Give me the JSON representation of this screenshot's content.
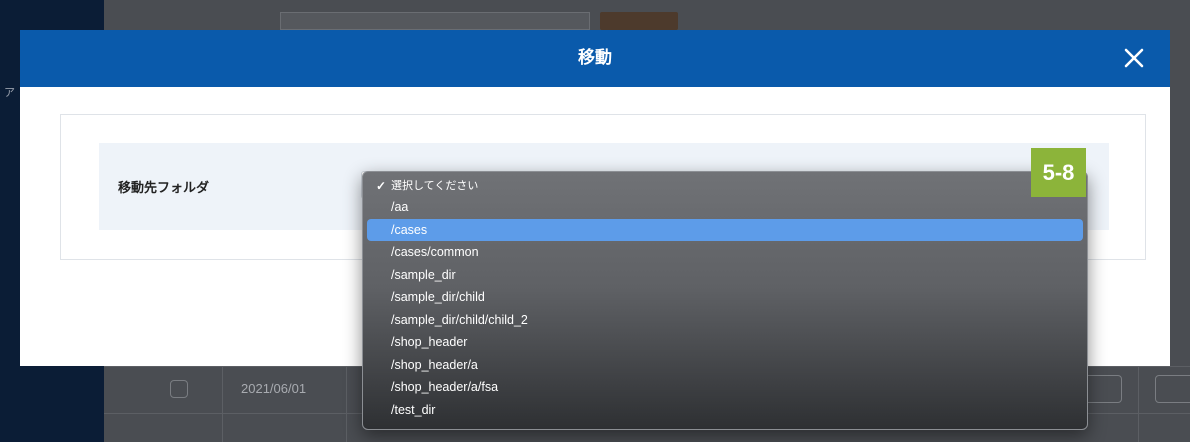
{
  "background": {
    "side_letter": "ア",
    "row_date": "2021/06/01"
  },
  "modal": {
    "title": "移動",
    "close_icon": "close-icon",
    "field_label": "移動先フォルダ"
  },
  "badge": "5-8",
  "dropdown": {
    "options": [
      {
        "label": "選択してください",
        "checked": true
      },
      {
        "label": "/aa"
      },
      {
        "label": "/cases",
        "highlighted": true
      },
      {
        "label": "/cases/common"
      },
      {
        "label": "/sample_dir"
      },
      {
        "label": "/sample_dir/child"
      },
      {
        "label": "/sample_dir/child/child_2"
      },
      {
        "label": "/shop_header"
      },
      {
        "label": "/shop_header/a"
      },
      {
        "label": "/shop_header/a/fsa"
      },
      {
        "label": "/test_dir"
      }
    ]
  },
  "colors": {
    "header": "#0a5aab",
    "highlight": "#5d9ce9",
    "badge": "#8cb43a"
  }
}
